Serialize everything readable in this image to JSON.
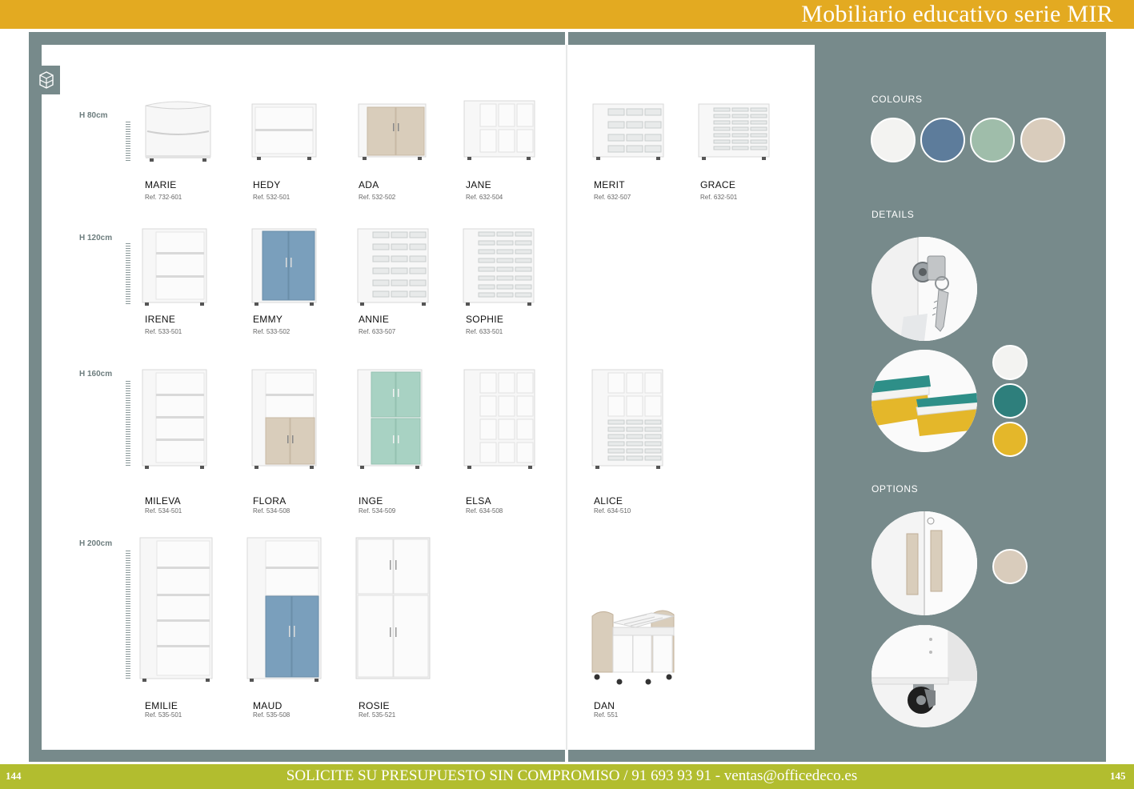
{
  "header": {
    "title": "Mobiliario educativo serie MIR"
  },
  "footer": {
    "cta": "SOLICITE SU PRESUPUESTO SIN COMPROMISO /  91 693 93 91 - ventas@officedeco.es",
    "page_left": "144",
    "page_right": "145"
  },
  "heights": [
    "H 80cm",
    "H 120cm",
    "H 160cm",
    "H 200cm"
  ],
  "products": [
    {
      "name": "MARIE",
      "ref": "Ref. 732-601"
    },
    {
      "name": "HEDY",
      "ref": "Ref. 532-501"
    },
    {
      "name": "ADA",
      "ref": "Ref. 532-502"
    },
    {
      "name": "JANE",
      "ref": "Ref. 632-504"
    },
    {
      "name": "MERIT",
      "ref": "Ref. 632-507"
    },
    {
      "name": "GRACE",
      "ref": "Ref. 632-501"
    },
    {
      "name": "IRENE",
      "ref": "Ref. 533-501"
    },
    {
      "name": "EMMY",
      "ref": "Ref. 533-502"
    },
    {
      "name": "ANNIE",
      "ref": "Ref. 633-507"
    },
    {
      "name": "SOPHIE",
      "ref": "Ref. 633-501"
    },
    {
      "name": "MILEVA",
      "ref": "Ref. 534-501"
    },
    {
      "name": "FLORA",
      "ref": "Ref. 534-508"
    },
    {
      "name": "INGE",
      "ref": "Ref. 534-509"
    },
    {
      "name": "ELSA",
      "ref": "Ref. 634-508"
    },
    {
      "name": "ALICE",
      "ref": "Ref. 634-510"
    },
    {
      "name": "EMILIE",
      "ref": "Ref. 535-501"
    },
    {
      "name": "MAUD",
      "ref": "Ref. 535-508"
    },
    {
      "name": "ROSIE",
      "ref": "Ref. 535-521"
    },
    {
      "name": "DAN",
      "ref": "Ref. 551"
    }
  ],
  "sections": {
    "colours": "COLOURS",
    "details": "DETAILS",
    "options": "OPTIONS"
  },
  "colours": [
    "#f3f3f1",
    "#5d7c9b",
    "#9fbdaa",
    "#d9ccbc"
  ],
  "tray_colours": [
    "#f3f3f1",
    "#2e7f7c",
    "#e4b72a"
  ],
  "option_colours": [
    "#d9ccbc"
  ],
  "palette": {
    "header": "#e3aa21",
    "frame": "#778a8b",
    "footer": "#b2bd2f",
    "blue_door": "#7a9fbc",
    "mint_door": "#a8d2c3",
    "oak": "#d9cdbb"
  }
}
